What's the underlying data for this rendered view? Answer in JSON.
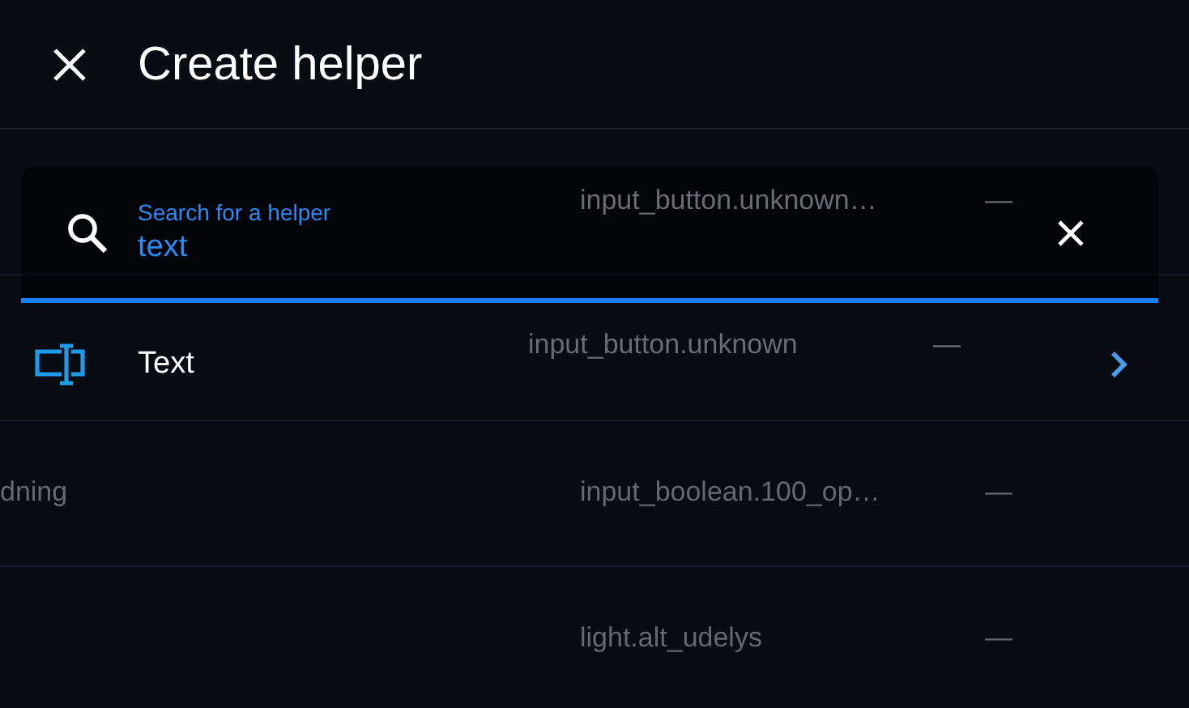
{
  "background_table": {
    "rows": [
      {
        "column_2": "input_button.unknown…",
        "column_3": "—"
      },
      {
        "column_2": "input_button.unknown",
        "column_3": "—"
      },
      {
        "column_1": "dning",
        "column_2": "input_boolean.100_op…",
        "column_3": "—"
      },
      {
        "column_2": "light.alt_udelys",
        "column_3": "—"
      }
    ]
  },
  "header": {
    "title": "Create helper"
  },
  "search": {
    "label": "Search for a helper",
    "value": "text"
  },
  "results": [
    {
      "label": "Text"
    }
  ]
}
